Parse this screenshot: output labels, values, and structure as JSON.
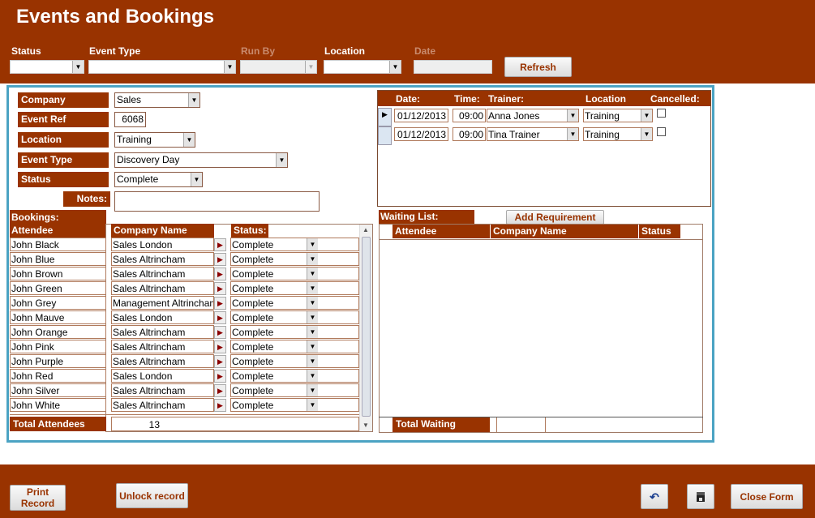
{
  "header": {
    "title": "Events and Bookings"
  },
  "filters": {
    "status_label": "Status",
    "event_type_label": "Event Type",
    "run_by_label": "Run By",
    "location_label": "Location",
    "date_label": "Date",
    "status_value": "",
    "event_type_value": "",
    "run_by_value": "",
    "location_value": "",
    "date_value": "",
    "refresh_label": "Refresh"
  },
  "form": {
    "company_label": "Company",
    "company_value": "Sales",
    "event_ref_label": "Event Ref",
    "event_ref_value": "6068",
    "location_label": "Location",
    "location_value": "Training",
    "event_type_label": "Event Type",
    "event_type_value": "Discovery Day",
    "status_label": "Status",
    "status_value": "Complete",
    "notes_label": "Notes:",
    "notes_value": ""
  },
  "sessions": {
    "headers": {
      "date": "Date:",
      "time": "Time:",
      "trainer": "Trainer:",
      "location": "Location",
      "cancelled": "Cancelled:"
    },
    "rows": [
      {
        "date": "01/12/2013",
        "time": "09:00",
        "trainer": "Anna Jones",
        "location": "Training",
        "cancelled": false,
        "current": true
      },
      {
        "date": "01/12/2013",
        "time": "09:00",
        "trainer": "Tina Trainer",
        "location": "Training",
        "cancelled": false,
        "current": false
      }
    ]
  },
  "bookings": {
    "label": "Bookings:",
    "headers": {
      "attendee": "Attendee",
      "company": "Company Name",
      "status": "Status:"
    },
    "rows": [
      {
        "attendee": "John Black",
        "company": "Sales London",
        "status": "Complete"
      },
      {
        "attendee": "John Blue",
        "company": "Sales Altrincham",
        "status": "Complete"
      },
      {
        "attendee": "John Brown",
        "company": "Sales Altrincham",
        "status": "Complete"
      },
      {
        "attendee": "John Green",
        "company": "Sales Altrincham",
        "status": "Complete"
      },
      {
        "attendee": "John Grey",
        "company": "Management Altrincham",
        "status": "Complete"
      },
      {
        "attendee": "John Mauve",
        "company": "Sales London",
        "status": "Complete"
      },
      {
        "attendee": "John Orange",
        "company": "Sales Altrincham",
        "status": "Complete"
      },
      {
        "attendee": "John Pink",
        "company": "Sales Altrincham",
        "status": "Complete"
      },
      {
        "attendee": "John Purple",
        "company": "Sales Altrincham",
        "status": "Complete"
      },
      {
        "attendee": "John Red",
        "company": "Sales London",
        "status": "Complete"
      },
      {
        "attendee": "John Silver",
        "company": "Sales Altrincham",
        "status": "Complete"
      },
      {
        "attendee": "John White",
        "company": "Sales Altrincham",
        "status": "Complete"
      }
    ],
    "total_label": "Total Attendees",
    "total_value": "13"
  },
  "waiting": {
    "label": "Waiting List:",
    "add_requirement": "Add Requirement",
    "headers": {
      "attendee": "Attendee",
      "company": "Company Name",
      "status": "Status"
    },
    "total_label": "Total Waiting",
    "total_value": ""
  },
  "footer": {
    "print": "Print Record",
    "unlock": "Unlock record",
    "close": "Close Form",
    "undo_icon": "undo-icon",
    "save_icon": "save-icon"
  },
  "colors": {
    "brand": "#993300",
    "frame": "#4ba3c3"
  }
}
